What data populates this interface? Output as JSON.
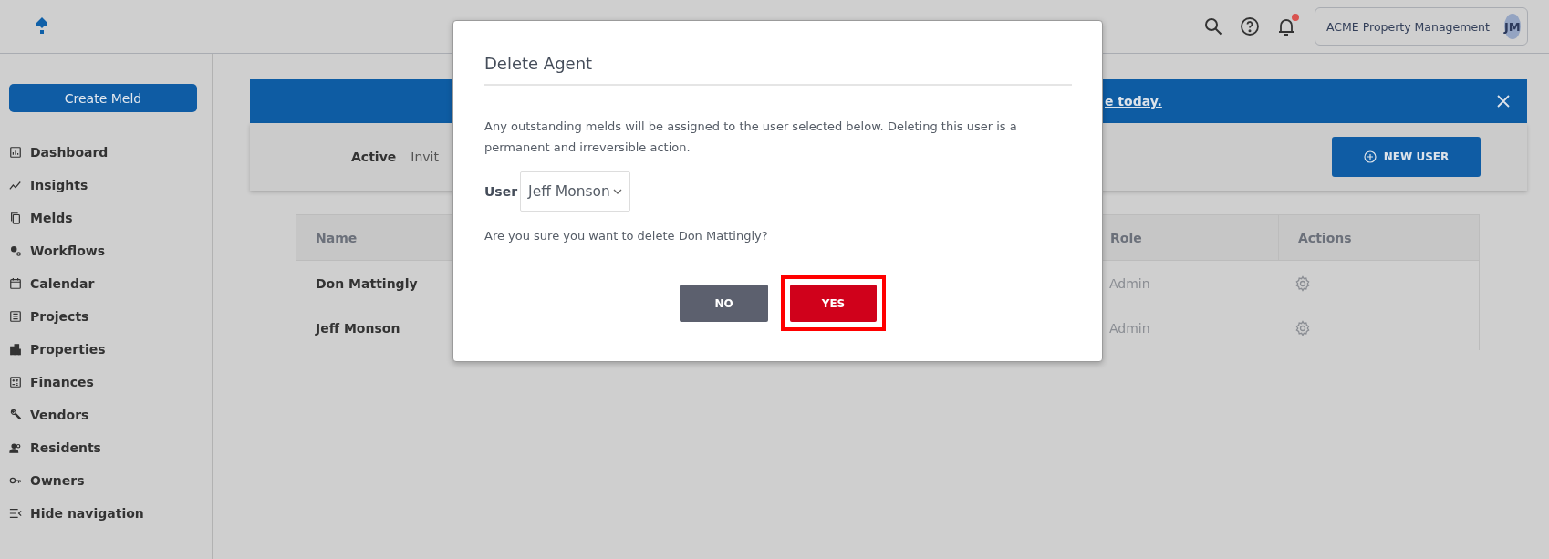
{
  "header": {
    "account": "ACME Property Management",
    "avatar": "JM",
    "notification_dot": true
  },
  "sidebar": {
    "create_button": "Create Meld",
    "items": [
      {
        "label": "Dashboard"
      },
      {
        "label": "Insights"
      },
      {
        "label": "Melds"
      },
      {
        "label": "Workflows"
      },
      {
        "label": "Calendar"
      },
      {
        "label": "Projects"
      },
      {
        "label": "Properties"
      },
      {
        "label": "Finances"
      },
      {
        "label": "Vendors"
      },
      {
        "label": "Residents"
      },
      {
        "label": "Owners"
      }
    ],
    "hide_nav": "Hide navigation"
  },
  "banner": {
    "link": "e today."
  },
  "tabs": [
    {
      "label": "Active",
      "selected": true
    },
    {
      "label": "Invit",
      "selected": false
    }
  ],
  "new_user_button": "NEW USER",
  "table": {
    "columns": [
      "Name",
      "Role",
      "Actions"
    ],
    "rows": [
      {
        "name": "Don Mattingly",
        "role": "Admin"
      },
      {
        "name": "Jeff Monson",
        "role": "Admin"
      }
    ]
  },
  "dialog": {
    "title": "Delete Agent",
    "message": "Any outstanding melds will be assigned to the user selected below. Deleting this user is a permanent and irreversible action.",
    "user_label": "User",
    "user_value": "Jeff Monson",
    "question": "Are you sure you want to delete Don Mattingly?",
    "buttons": [
      {
        "label": "NO",
        "kind": "secondary",
        "highlighted": false
      },
      {
        "label": "YES",
        "kind": "danger",
        "highlighted": true
      }
    ]
  }
}
